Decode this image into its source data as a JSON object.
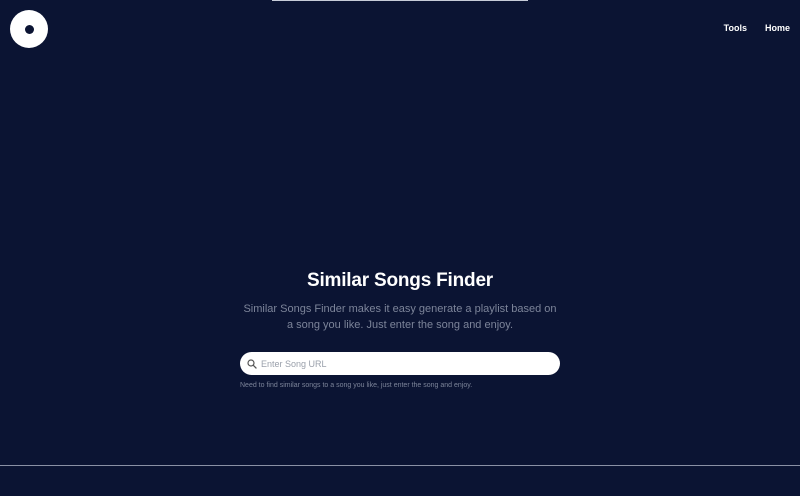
{
  "nav": {
    "items": [
      {
        "label": "Tools"
      },
      {
        "label": "Home"
      }
    ]
  },
  "hero": {
    "title": "Similar Songs Finder",
    "subtitle": "Similar Songs Finder makes it easy generate a playlist based on a song you like. Just enter the song and enjoy."
  },
  "search": {
    "placeholder": "Enter Song URL",
    "value": "",
    "icon": "search-icon",
    "helper_text": "Need to find similar songs to a song you like, just enter the song and enjoy."
  },
  "colors": {
    "background": "#0b1433",
    "text": "#ffffff",
    "muted": "#7c8499"
  }
}
